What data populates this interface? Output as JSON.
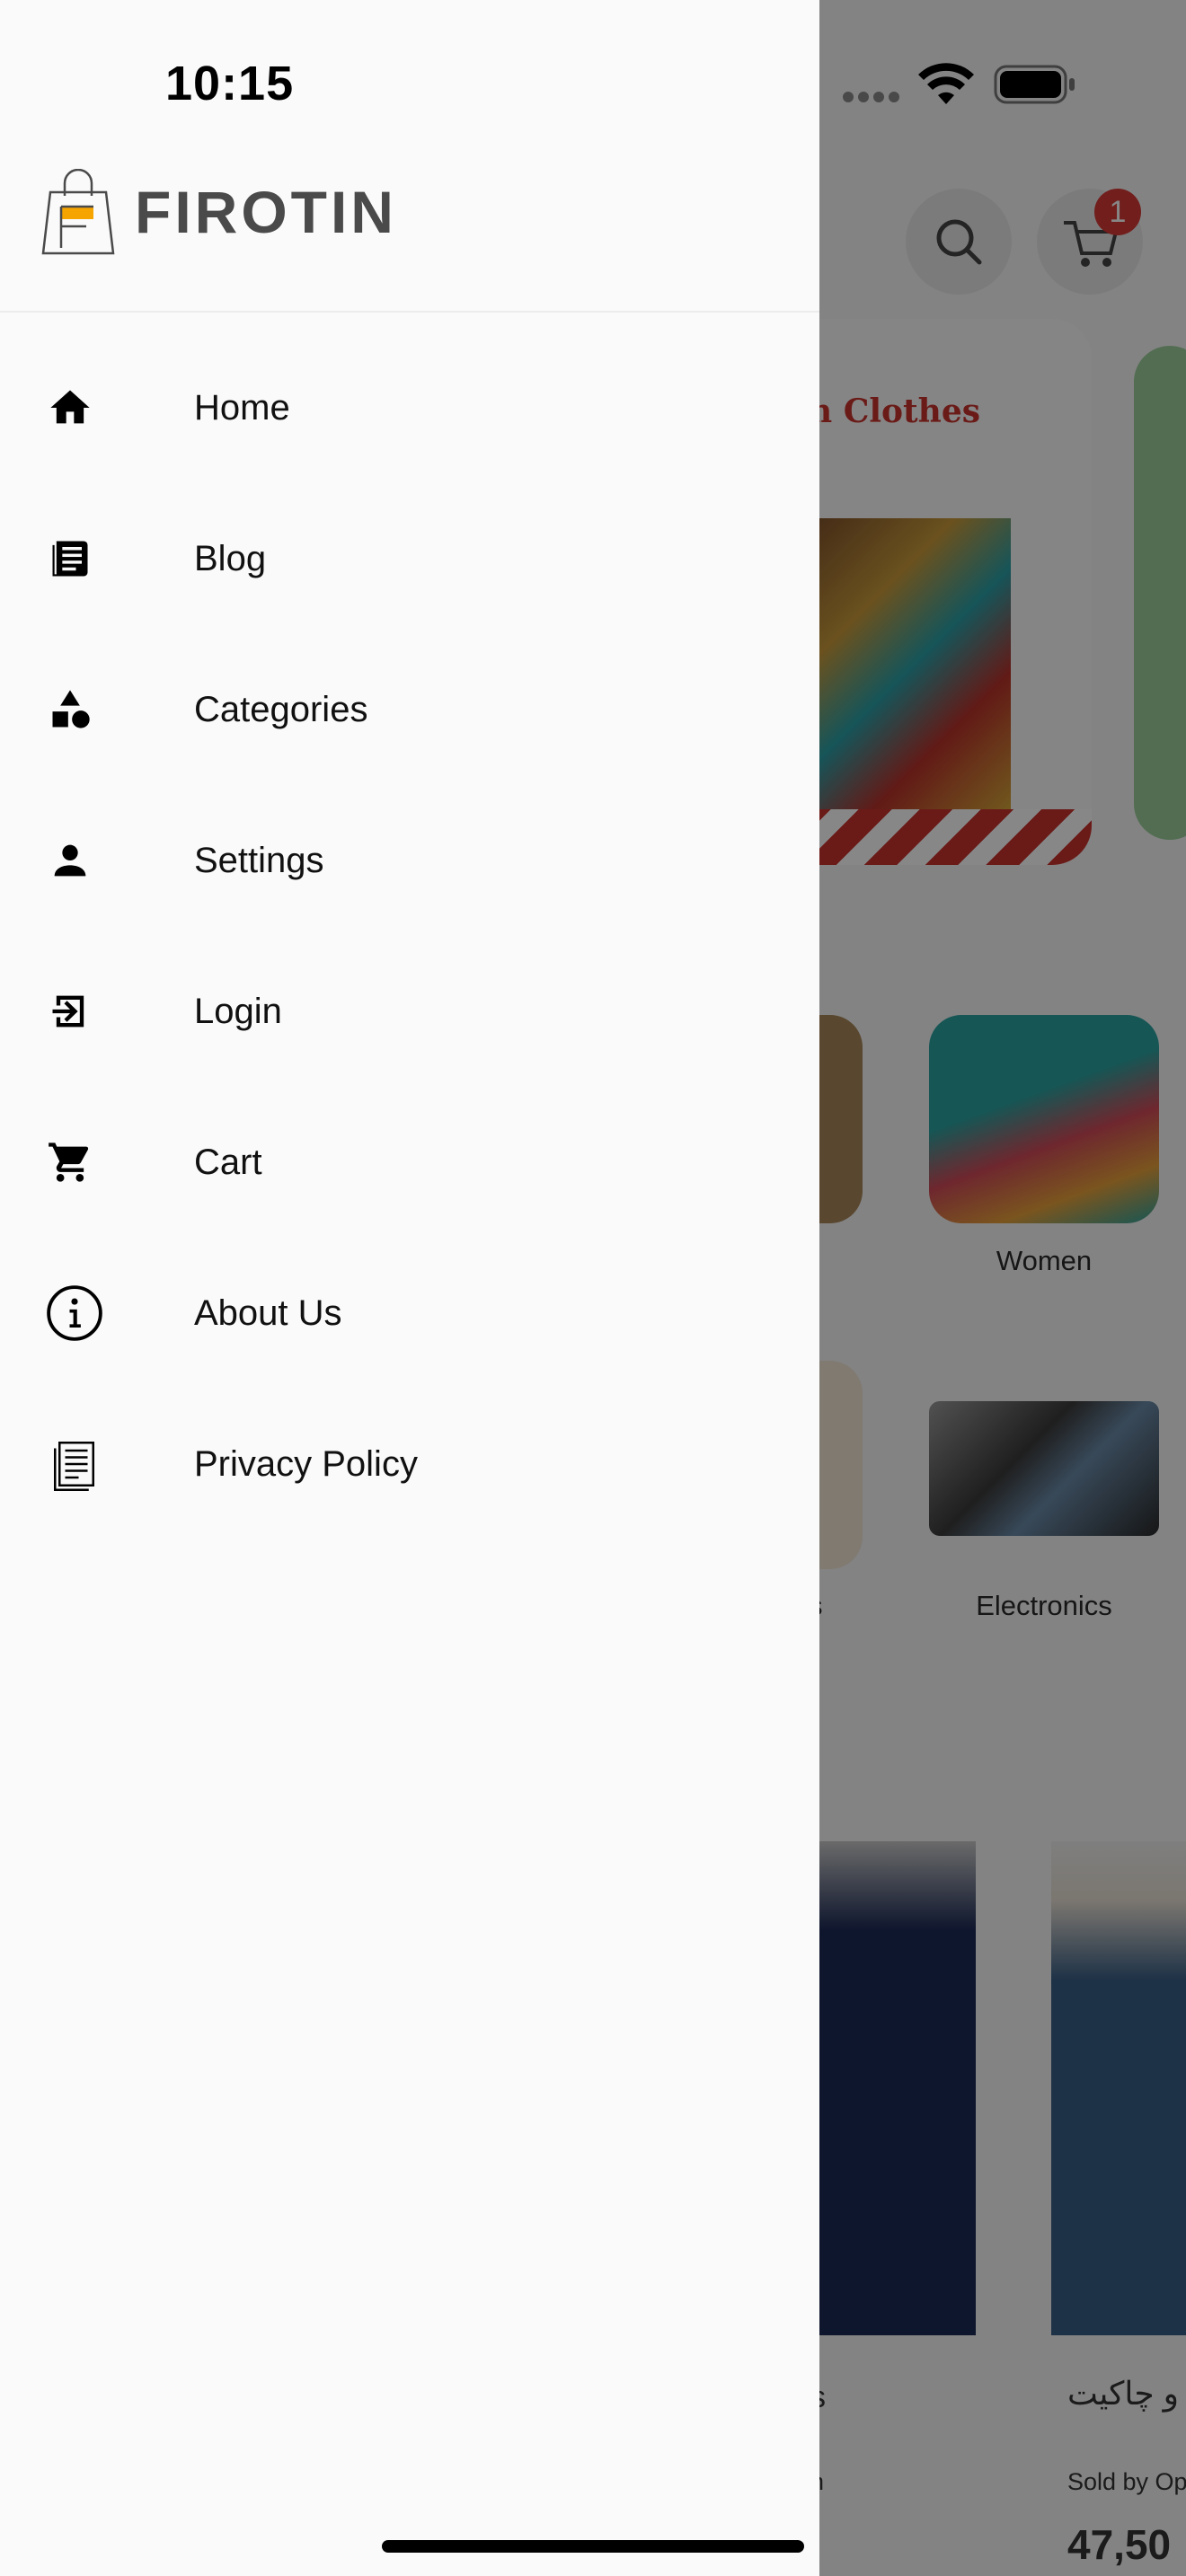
{
  "status_bar": {
    "time": "10:15"
  },
  "app": {
    "brand_name": "FIROTIN",
    "cart_badge_count": "1"
  },
  "drawer": {
    "menu": [
      {
        "label": "Home",
        "icon": "home-icon"
      },
      {
        "label": "Blog",
        "icon": "blog-icon"
      },
      {
        "label": "Categories",
        "icon": "categories-icon"
      },
      {
        "label": "Settings",
        "icon": "person-icon"
      },
      {
        "label": "Login",
        "icon": "login-icon"
      },
      {
        "label": "Cart",
        "icon": "cart-icon"
      },
      {
        "label": "About Us",
        "icon": "info-icon"
      },
      {
        "label": "Privacy Policy",
        "icon": "document-icon"
      }
    ]
  },
  "background": {
    "banner_title": "n Clothes",
    "categories": [
      {
        "label": "Women"
      },
      {
        "label": "s"
      },
      {
        "label": "Electronics"
      }
    ],
    "product_title": "و چاکیت",
    "product_seller": "Sold by Op",
    "product_price": "47,50",
    "product_partial": "n",
    "product_partial2": "s"
  },
  "colors": {
    "accent": "#f5a400",
    "badge": "#d63a35",
    "drawer_bg": "#fafafa"
  }
}
